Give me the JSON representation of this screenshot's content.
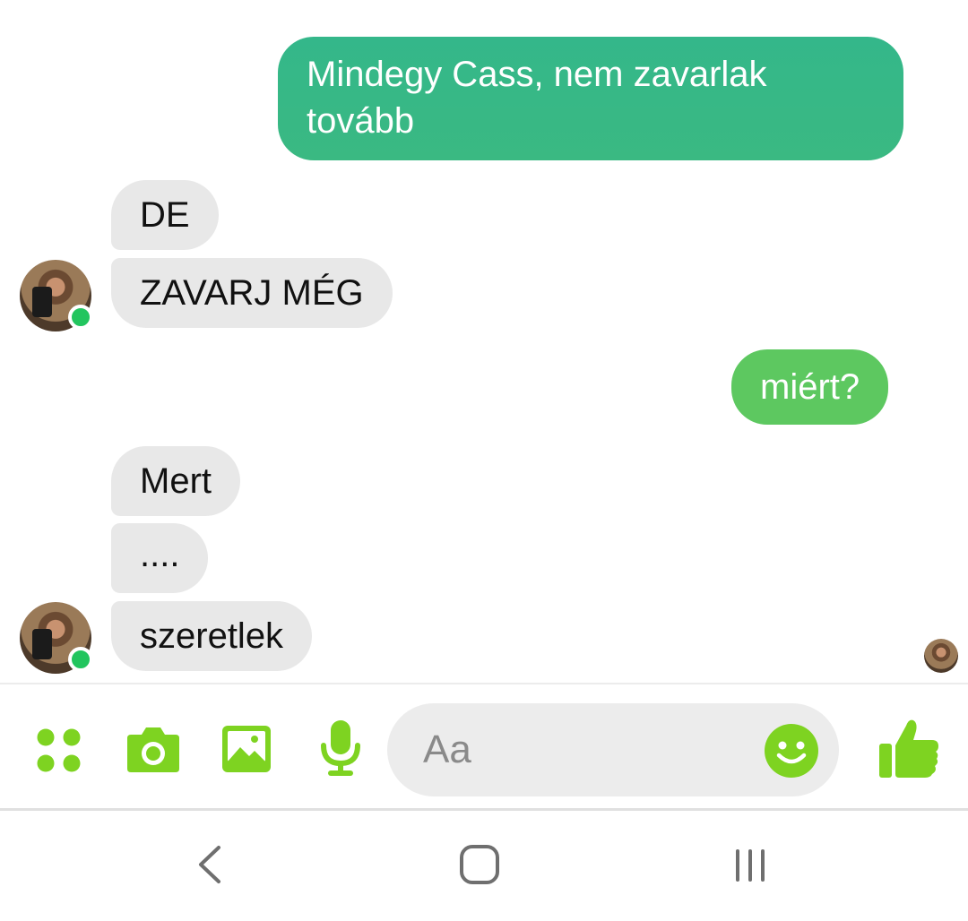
{
  "conversation": {
    "messages": [
      {
        "sender": "me",
        "text": "Mindegy Cass, nem zavarlak tovább"
      },
      {
        "sender": "contact",
        "text": "DE"
      },
      {
        "sender": "contact",
        "text": "ZAVARJ MÉG"
      },
      {
        "sender": "me",
        "text": "miért?"
      },
      {
        "sender": "contact",
        "text": "Mert"
      },
      {
        "sender": "contact",
        "text": "...."
      },
      {
        "sender": "contact",
        "text": "szeretlek"
      }
    ]
  },
  "composer": {
    "placeholder": "Aa",
    "icons": [
      "apps-icon",
      "camera-icon",
      "image-icon",
      "microphone-icon",
      "emoji-icon",
      "thumbs-up-icon"
    ]
  },
  "navigation": {
    "icons": [
      "back-icon",
      "home-icon",
      "recent-apps-icon"
    ]
  },
  "colors": {
    "accent": "#7ed321",
    "sent_bubble_teal": "#34b78a",
    "sent_bubble_green": "#5dc860",
    "received_bubble": "#e8e8e8",
    "online_indicator": "#22c55e"
  }
}
